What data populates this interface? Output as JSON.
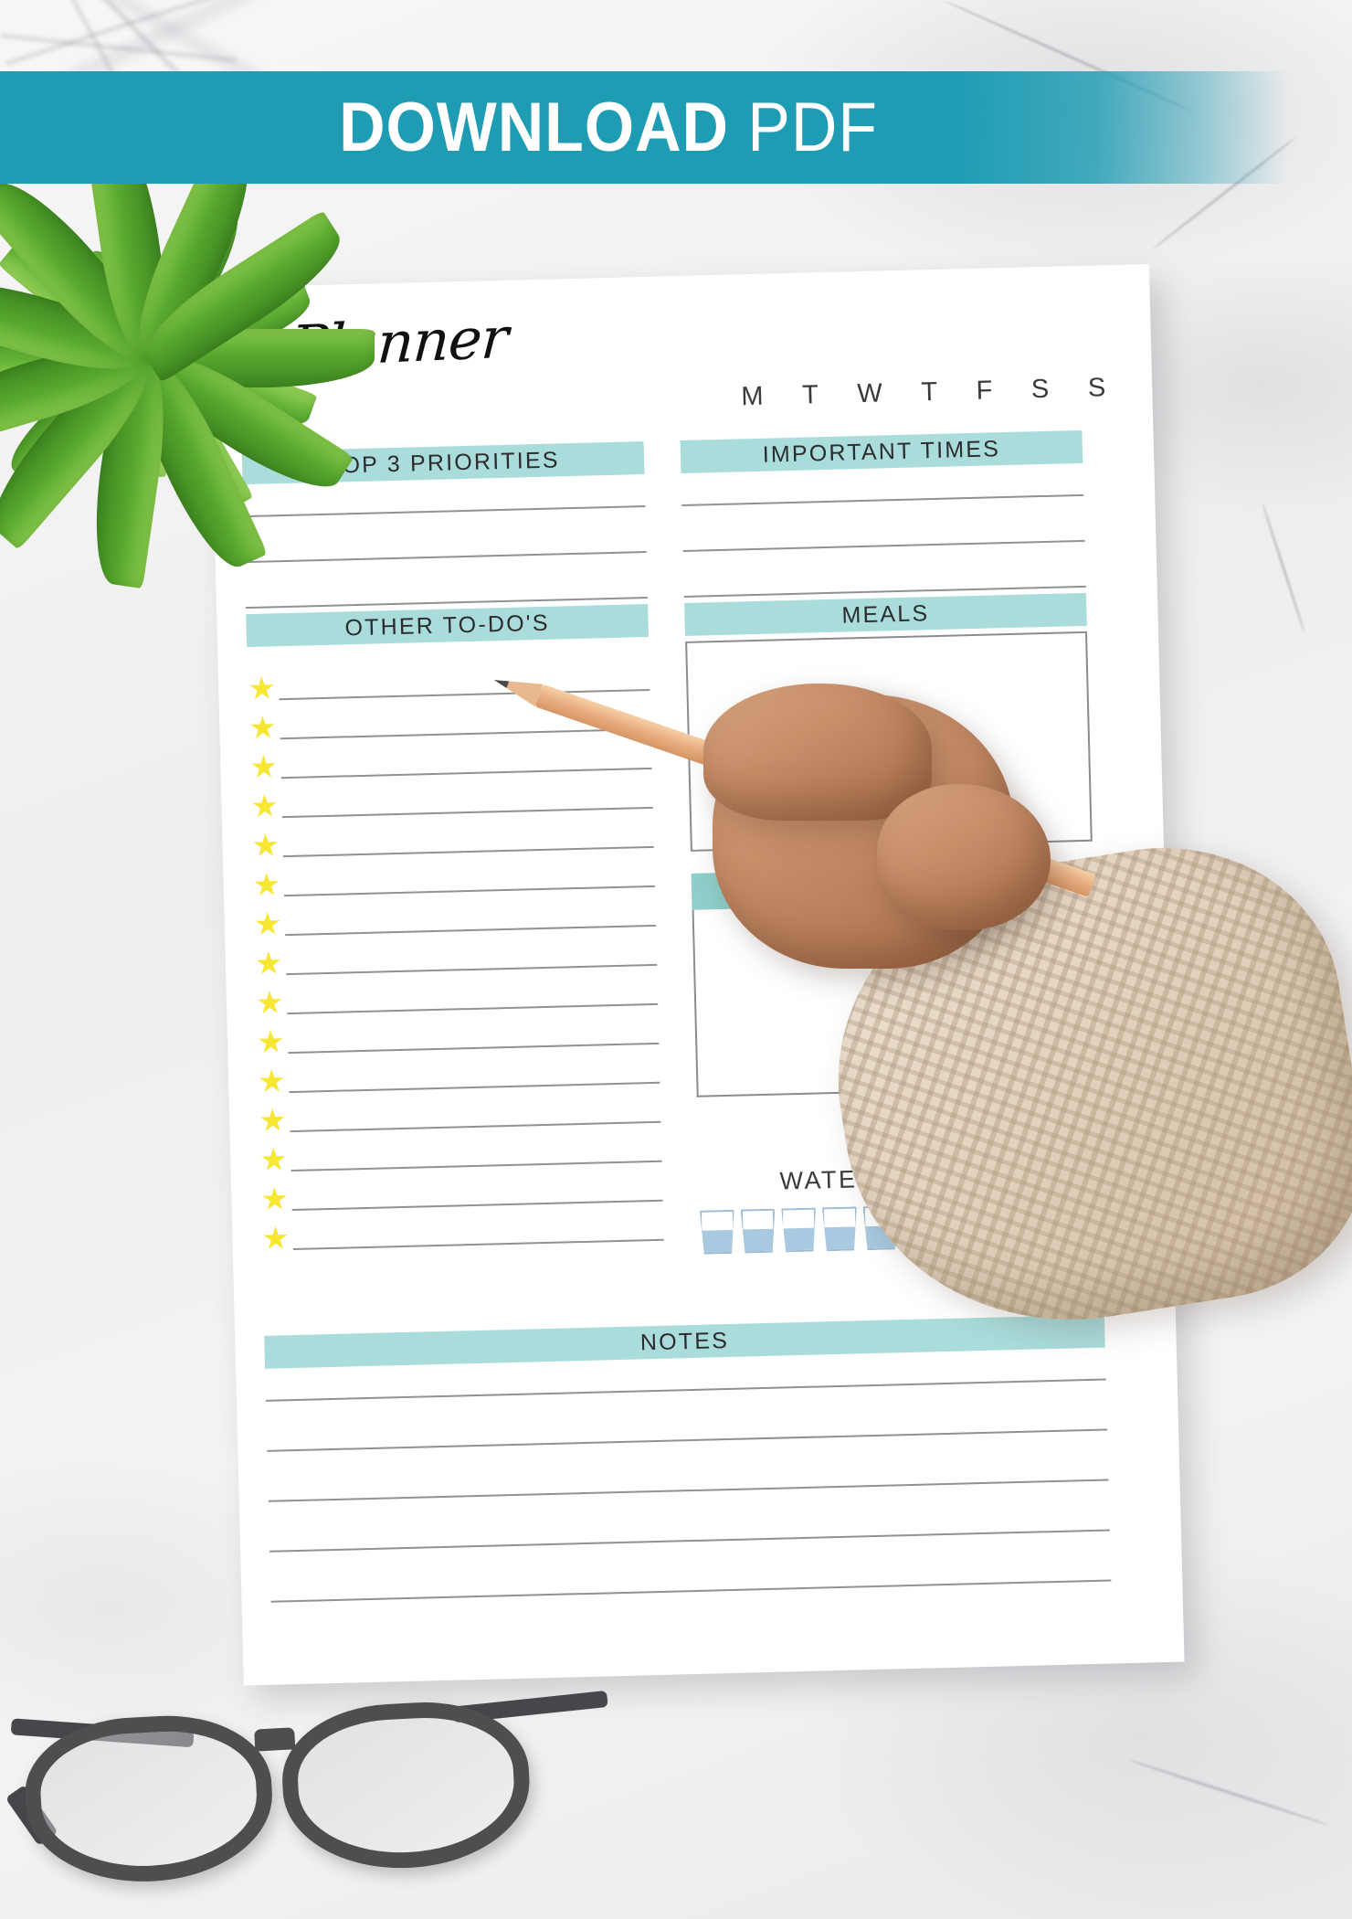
{
  "banner": {
    "word_strong": "DOWNLOAD",
    "word_light": "PDF",
    "background_color": "#1e9cb4",
    "text_color": "#ffffff"
  },
  "planner": {
    "title": "Planner",
    "days": [
      "M",
      "T",
      "W",
      "T",
      "F",
      "S",
      "S"
    ],
    "accent_header_color": "#aadcdc",
    "accent_subheader_color": "#8fcfcb",
    "star_color": "#f7e733",
    "rule_color": "#8f9194",
    "sections": {
      "top_priorities": {
        "label": "TOP 3 PRIORITIES",
        "line_count": 3
      },
      "important_times": {
        "label": "IMPORTANT TIMES",
        "line_count": 3
      },
      "other_todos": {
        "label": "OTHER TO-DO'S",
        "line_count": 15
      },
      "meals": {
        "label": "MEALS"
      },
      "water_tracker": {
        "label": "WATER TRACKER",
        "glass_count": 10
      },
      "notes": {
        "label": "NOTES",
        "line_count": 5
      }
    }
  },
  "decor": {
    "plant": "potted-green-plant",
    "hand": "hand-holding-pencil",
    "pencil": "pencil",
    "sleeve": "knit-sweater-sleeve",
    "glasses": "eyeglasses",
    "background": "white-marble-surface"
  }
}
